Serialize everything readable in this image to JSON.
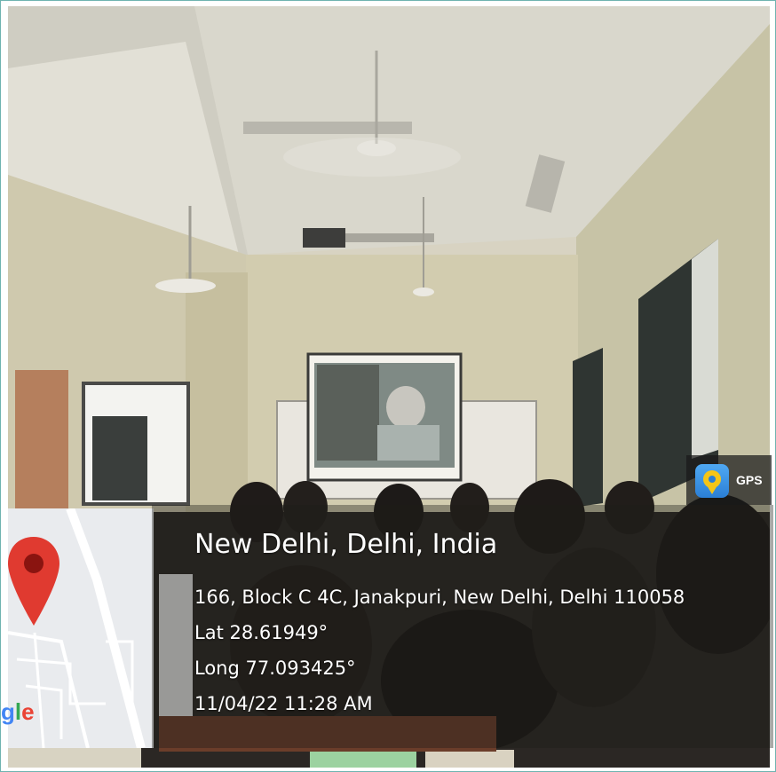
{
  "gps_stamp": {
    "badge_label": "GPS",
    "location_title": "New Delhi, Delhi, India",
    "address": "166, Block C 4C, Janakpuri, New Delhi, Delhi 110058",
    "latitude": "Lat 28.61949°",
    "longitude": "Long 77.093425°",
    "datetime": "11/04/22 11:28 AM"
  },
  "map": {
    "logo_text": "gle",
    "logo_colors": [
      "#4285f4",
      "#34a853",
      "#ea4335"
    ],
    "pin_color": "#e03a30"
  },
  "colors": {
    "frame_border": "#6fb3b0",
    "overlay_text": "#ffffff"
  }
}
